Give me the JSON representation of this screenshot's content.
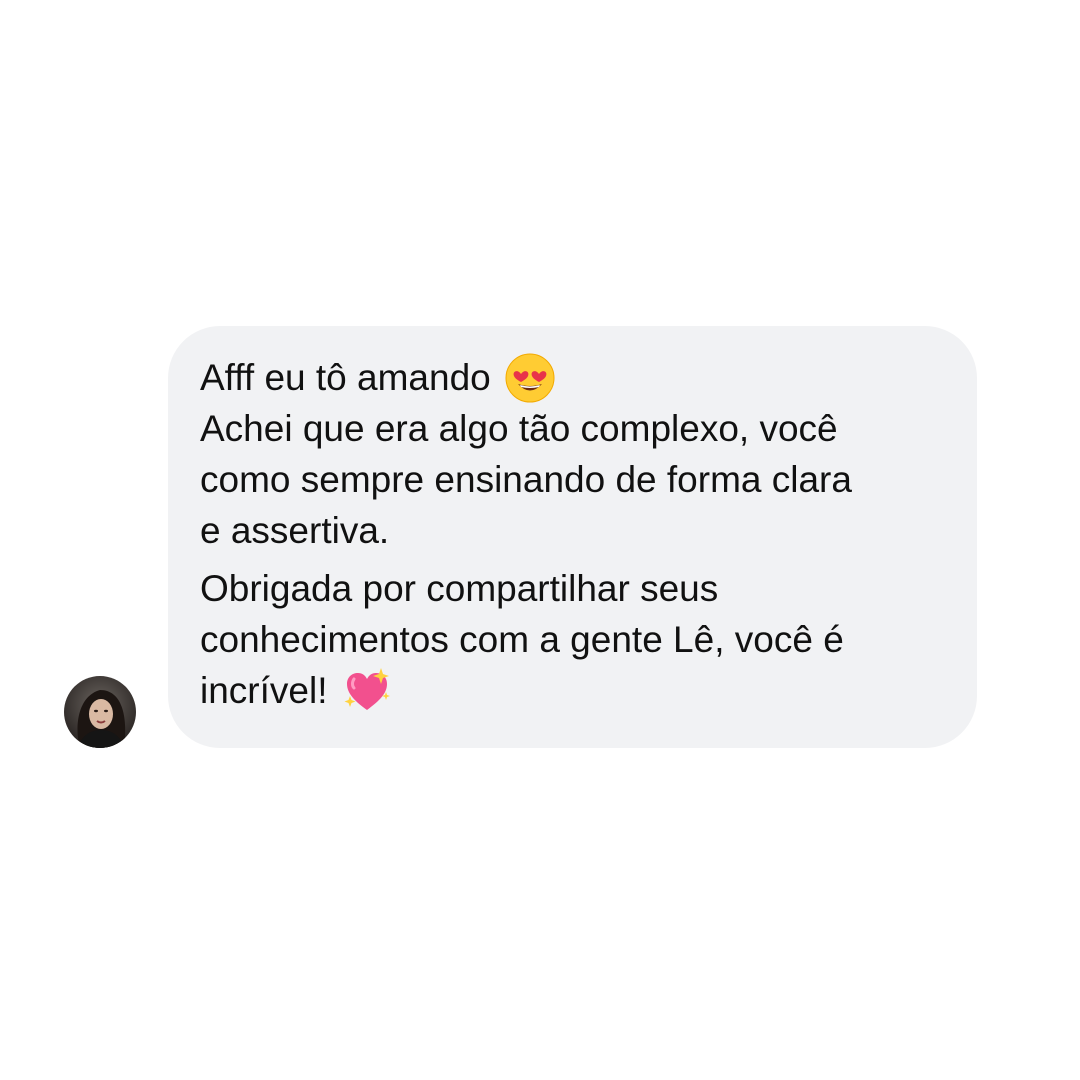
{
  "message": {
    "lines": [
      "Afff eu tô amando",
      "Achei que era algo tão complexo, você",
      "como sempre ensinando de forma clara",
      "e assertiva.",
      "Obrigada por compartilhar seus",
      "conhecimentos com a gente Lê, você é",
      "incrível!"
    ],
    "emojis": [
      "heart-eyes-emoji",
      "sparkling-heart-emoji"
    ]
  },
  "sender": {
    "avatar": "avatar"
  },
  "colors": {
    "background": "#FFFFFF",
    "bubble": "#F1F2F4",
    "text": "#111111"
  }
}
